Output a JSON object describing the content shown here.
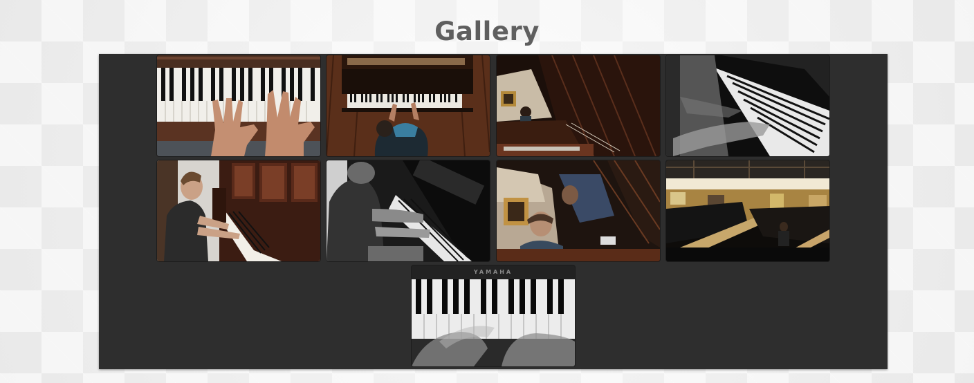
{
  "page": {
    "title": "Gallery"
  },
  "gallery": {
    "photos": [
      {
        "name": "gallery-photo-hands-upright-keys"
      },
      {
        "name": "gallery-photo-overhead-grand"
      },
      {
        "name": "gallery-photo-reflection-lid"
      },
      {
        "name": "gallery-photo-bw-motion-blur"
      },
      {
        "name": "gallery-photo-player-carved-upright"
      },
      {
        "name": "gallery-photo-bw-player-side"
      },
      {
        "name": "gallery-photo-lid-reflection-store"
      },
      {
        "name": "gallery-photo-showroom-grands"
      },
      {
        "name": "gallery-photo-yamaha-keys-blur",
        "brand_text": "YAMAHA"
      }
    ]
  }
}
